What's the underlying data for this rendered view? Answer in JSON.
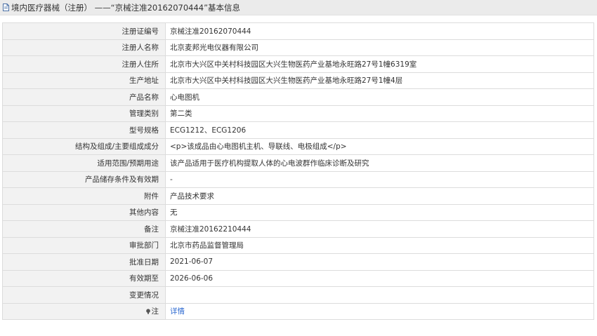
{
  "header": {
    "icon": "document-icon",
    "title": "境内医疗器械（注册） ——“京械注准20162070444”基本信息"
  },
  "rows": [
    {
      "label": "注册证编号",
      "value": "京械注准20162070444"
    },
    {
      "label": "注册人名称",
      "value": "北京麦邦光电仪器有限公司"
    },
    {
      "label": "注册人住所",
      "value": "北京市大兴区中关村科技园区大兴生物医药产业基地永旺路27号1幢6319室"
    },
    {
      "label": "生产地址",
      "value": "北京市大兴区中关村科技园区大兴生物医药产业基地永旺路27号1幢4层"
    },
    {
      "label": "产品名称",
      "value": "心电图机"
    },
    {
      "label": "管理类别",
      "value": "第二类"
    },
    {
      "label": "型号规格",
      "value": "ECG1212、ECG1206"
    },
    {
      "label": "结构及组成/主要组成成分",
      "value": "<p>该成品由心电图机主机、导联线、电极组成</p>"
    },
    {
      "label": "适用范围/预期用途",
      "value": "该产品适用于医疗机构提取人体的心电波群作临床诊断及研究"
    },
    {
      "label": "产品储存条件及有效期",
      "value": "-"
    },
    {
      "label": "附件",
      "value": "产品技术要求"
    },
    {
      "label": "其他内容",
      "value": "无"
    },
    {
      "label": "备注",
      "value": "京械注准20162210444"
    },
    {
      "label": "审批部门",
      "value": "北京市药品监督管理局"
    },
    {
      "label": "批准日期",
      "value": "2021-06-07"
    },
    {
      "label": "有效期至",
      "value": "2026-06-06"
    },
    {
      "label": "变更情况",
      "value": ""
    }
  ],
  "note": {
    "icon": "note-icon",
    "label": "注",
    "link_text": "详情"
  },
  "colors": {
    "label_bg": "#f2f2f2",
    "border": "#dcdcdc",
    "header_bg": "#ebebeb",
    "link": "#2f6bd1"
  }
}
